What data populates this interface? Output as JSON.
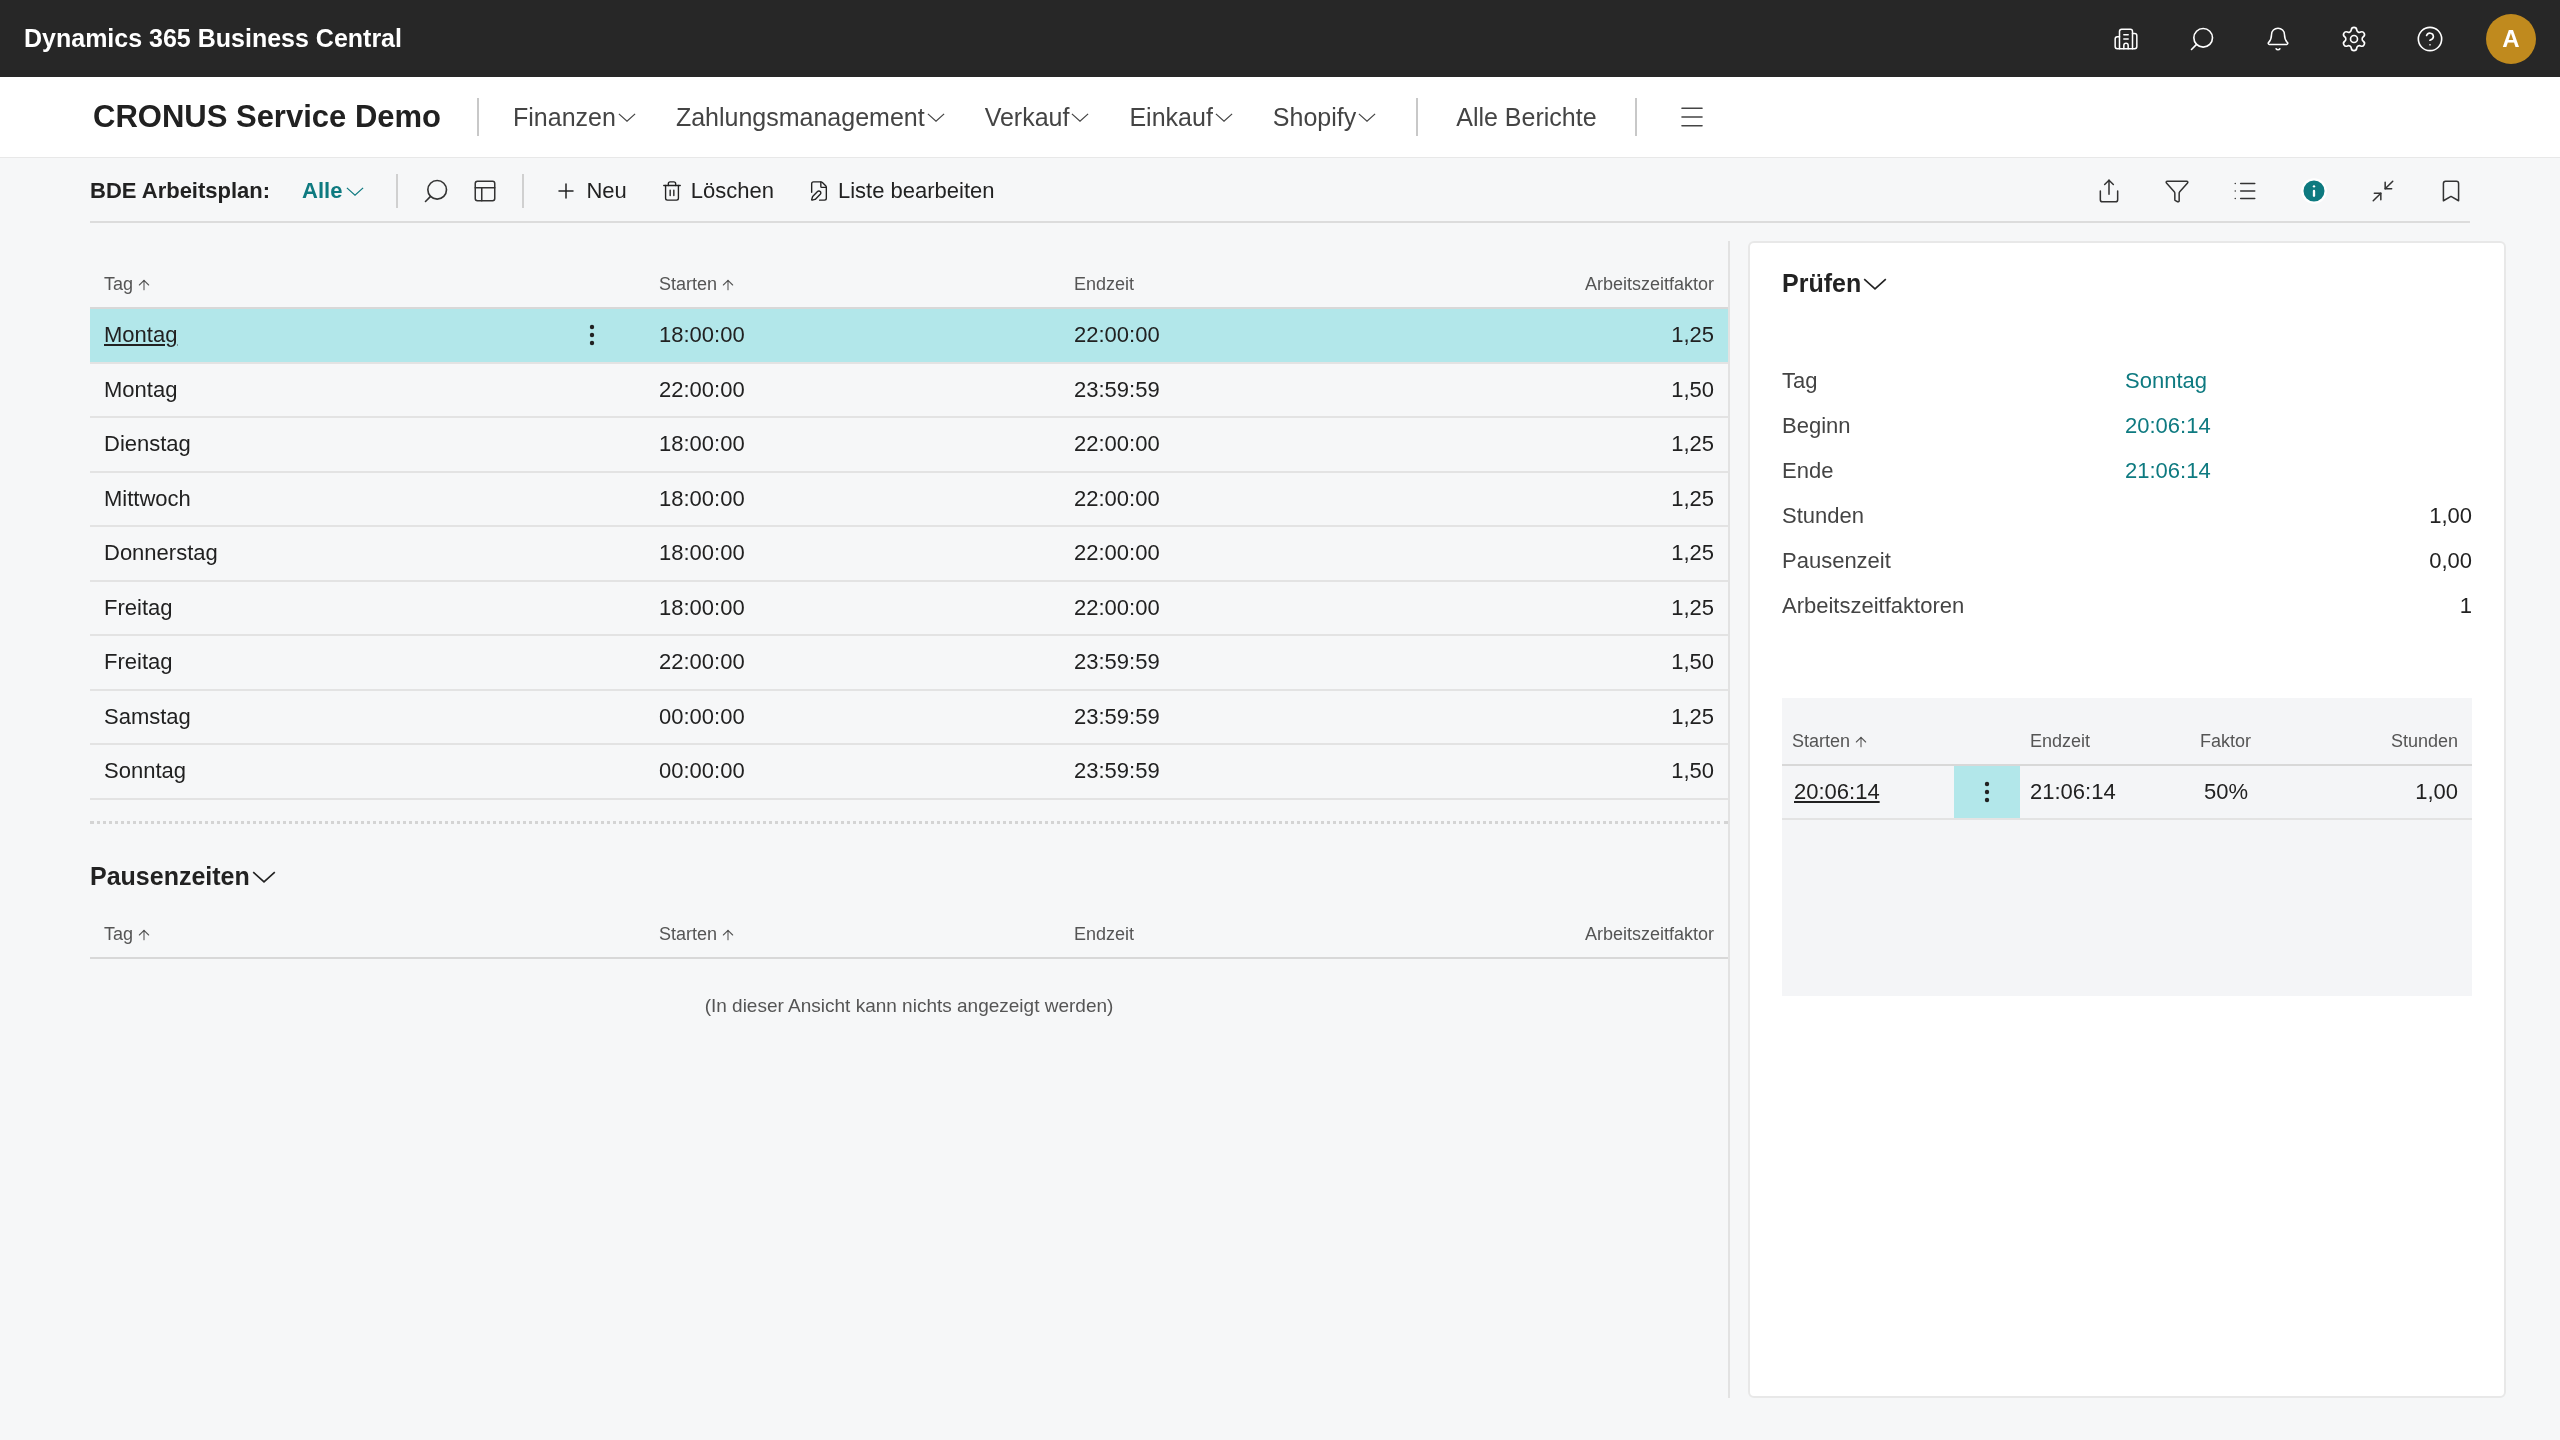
{
  "header": {
    "app_title": "Dynamics 365 Business Central",
    "avatar": "A"
  },
  "nav": {
    "company": "CRONUS Service Demo",
    "menus": [
      {
        "label": "Finanzen"
      },
      {
        "label": "Zahlungsmanagement"
      },
      {
        "label": "Verkauf"
      },
      {
        "label": "Einkauf"
      },
      {
        "label": "Shopify"
      }
    ],
    "reports": "Alle Berichte"
  },
  "toolbar": {
    "label": "BDE Arbeitsplan:",
    "filter": "Alle",
    "actions": [
      {
        "kind": "new",
        "label": "Neu"
      },
      {
        "kind": "delete",
        "label": "Löschen"
      },
      {
        "kind": "edit",
        "label": "Liste bearbeiten"
      }
    ]
  },
  "schedule": {
    "columns": [
      {
        "label": "Tag",
        "sorted": true
      },
      {
        "label": "Starten",
        "sorted": true
      },
      {
        "label": "Endzeit",
        "sorted": false
      },
      {
        "label": "Arbeitszeitfaktor",
        "sorted": false
      }
    ],
    "rows": [
      {
        "day": "Montag",
        "start": "18:00:00",
        "end": "22:00:00",
        "factor": "1,25",
        "selected": true
      },
      {
        "day": "Montag",
        "start": "22:00:00",
        "end": "23:59:59",
        "factor": "1,50",
        "selected": false
      },
      {
        "day": "Dienstag",
        "start": "18:00:00",
        "end": "22:00:00",
        "factor": "1,25",
        "selected": false
      },
      {
        "day": "Mittwoch",
        "start": "18:00:00",
        "end": "22:00:00",
        "factor": "1,25",
        "selected": false
      },
      {
        "day": "Donnerstag",
        "start": "18:00:00",
        "end": "22:00:00",
        "factor": "1,25",
        "selected": false
      },
      {
        "day": "Freitag",
        "start": "18:00:00",
        "end": "22:00:00",
        "factor": "1,25",
        "selected": false
      },
      {
        "day": "Freitag",
        "start": "22:00:00",
        "end": "23:59:59",
        "factor": "1,50",
        "selected": false
      },
      {
        "day": "Samstag",
        "start": "00:00:00",
        "end": "23:59:59",
        "factor": "1,25",
        "selected": false
      },
      {
        "day": "Sonntag",
        "start": "00:00:00",
        "end": "23:59:59",
        "factor": "1,50",
        "selected": false
      }
    ]
  },
  "breaks": {
    "title": "Pausenzeiten",
    "columns": [
      {
        "label": "Tag",
        "sorted": true
      },
      {
        "label": "Starten",
        "sorted": true
      },
      {
        "label": "Endzeit",
        "sorted": false
      },
      {
        "label": "Arbeitszeitfaktor",
        "sorted": false
      }
    ],
    "empty_text": "(In dieser Ansicht kann nichts angezeigt werden)"
  },
  "factbox": {
    "title": "Prüfen",
    "fields": [
      {
        "label": "Tag",
        "value": "Sonntag",
        "kind": "link"
      },
      {
        "label": "Beginn",
        "value": "20:06:14",
        "kind": "link"
      },
      {
        "label": "Ende",
        "value": "21:06:14",
        "kind": "link"
      },
      {
        "label": "Stunden",
        "value": "1,00",
        "kind": "number"
      },
      {
        "label": "Pausenzeit",
        "value": "0,00",
        "kind": "number"
      },
      {
        "label": "Arbeitszeitfaktoren",
        "value": "1",
        "kind": "number"
      }
    ],
    "table": {
      "columns": [
        {
          "label": "Starten",
          "sorted": true
        },
        {
          "label": "Endzeit",
          "sorted": false
        },
        {
          "label": "Faktor",
          "sorted": false
        },
        {
          "label": "Stunden",
          "sorted": false
        }
      ],
      "rows": [
        {
          "start": "20:06:14",
          "end": "21:06:14",
          "factor": "50%",
          "hours": "1,00",
          "selected": true
        }
      ]
    }
  }
}
